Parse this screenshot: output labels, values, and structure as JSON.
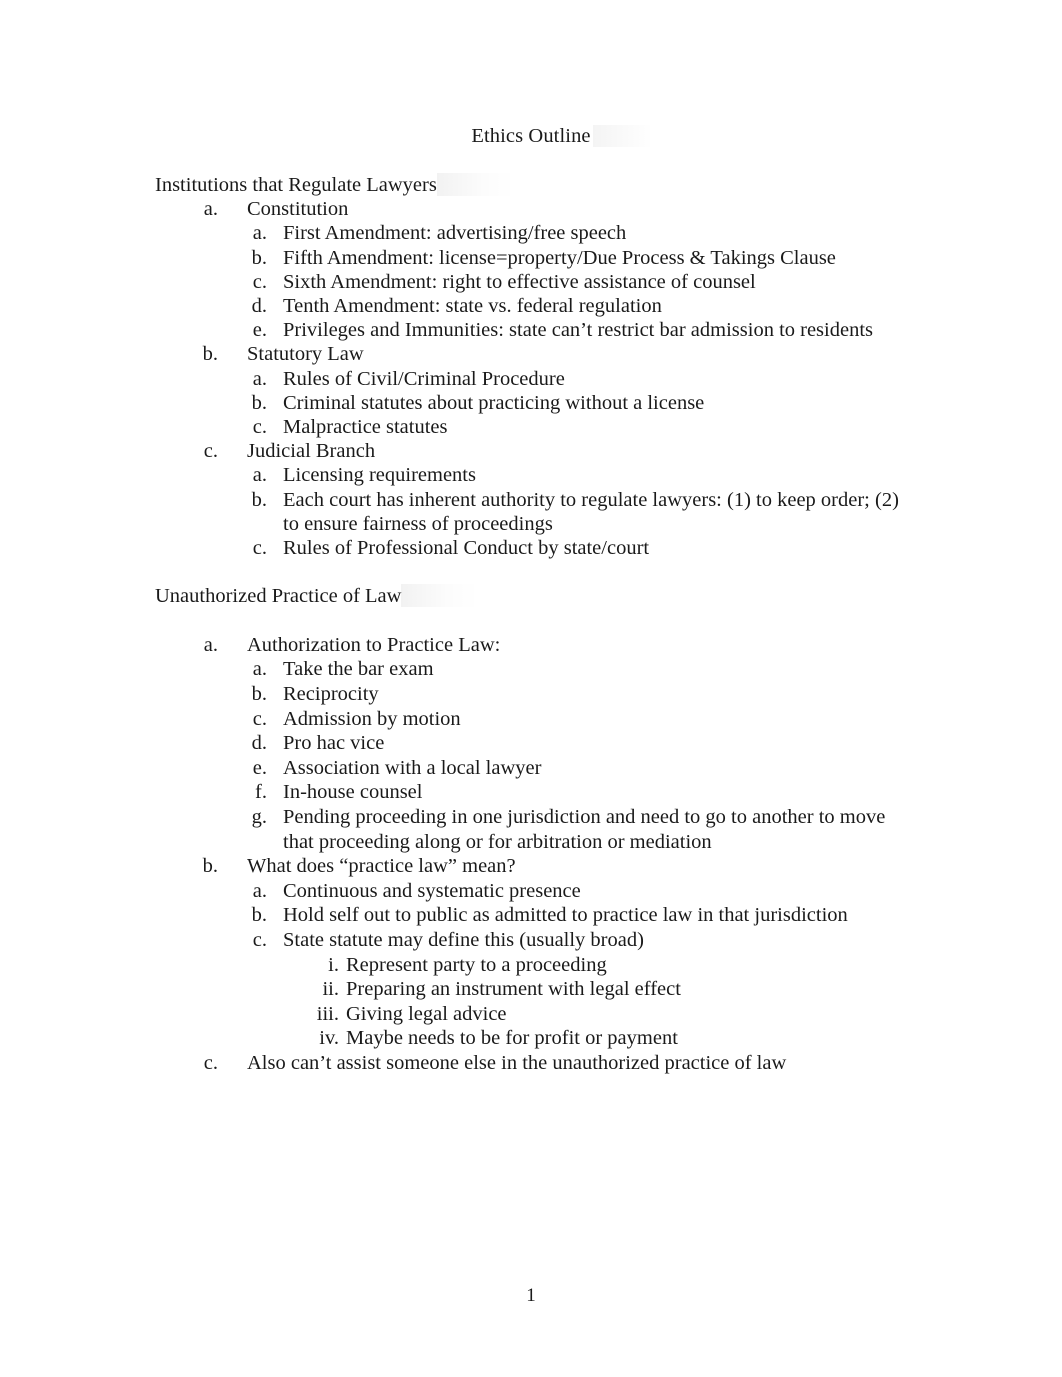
{
  "document": {
    "title": "Ethics Outline",
    "page_number": "1"
  },
  "sections": [
    {
      "heading": "Institutions that Regulate Lawyers",
      "items": [
        {
          "level": 1,
          "marker": "a.",
          "text": "Constitution"
        },
        {
          "level": 2,
          "marker": "a.",
          "text": "First Amendment: advertising/free speech"
        },
        {
          "level": 2,
          "marker": "b.",
          "text": "Fifth Amendment: license=property/Due Process & Takings Clause"
        },
        {
          "level": 2,
          "marker": "c.",
          "text": "Sixth Amendment: right to effective assistance of counsel"
        },
        {
          "level": 2,
          "marker": "d.",
          "text": "Tenth Amendment: state vs. federal regulation"
        },
        {
          "level": 2,
          "marker": "e.",
          "text": "Privileges and Immunities: state can’t restrict bar admission to residents"
        },
        {
          "level": 1,
          "marker": "b.",
          "text": "Statutory Law"
        },
        {
          "level": 2,
          "marker": "a.",
          "text": "Rules of Civil/Criminal Procedure"
        },
        {
          "level": 2,
          "marker": "b.",
          "text": "Criminal statutes about practicing without a license"
        },
        {
          "level": 2,
          "marker": "c.",
          "text": "Malpractice statutes"
        },
        {
          "level": 1,
          "marker": "c.",
          "text": "Judicial Branch"
        },
        {
          "level": 2,
          "marker": "a.",
          "text": "Licensing requirements"
        },
        {
          "level": 2,
          "marker": "b.",
          "text": "Each court has inherent authority to regulate lawyers: (1) to keep order; (2) to ensure fairness of proceedings"
        },
        {
          "level": 2,
          "marker": "c.",
          "text": "Rules of Professional Conduct by state/court"
        }
      ]
    },
    {
      "heading": "Unauthorized Practice of Law",
      "items": [
        {
          "level": 1,
          "marker": "a.",
          "text": "Authorization to Practice Law:"
        },
        {
          "level": 2,
          "marker": "a.",
          "text": "Take the bar exam"
        },
        {
          "level": 2,
          "marker": "b.",
          "text": "Reciprocity"
        },
        {
          "level": 2,
          "marker": "c.",
          "text": "Admission by motion"
        },
        {
          "level": 2,
          "marker": "d.",
          "text": "Pro hac vice"
        },
        {
          "level": 2,
          "marker": "e.",
          "text": "Association with a local lawyer"
        },
        {
          "level": 2,
          "marker": "f.",
          "text": "In-house counsel"
        },
        {
          "level": 2,
          "marker": "g.",
          "text": "Pending proceeding in one jurisdiction and need to go to another to move that proceeding along or for arbitration or mediation"
        },
        {
          "level": 1,
          "marker": "b.",
          "text": "What does “practice law” mean?"
        },
        {
          "level": 2,
          "marker": "a.",
          "text": "Continuous and systematic presence"
        },
        {
          "level": 2,
          "marker": "b.",
          "text": "Hold self out to public as admitted to practice law in that jurisdiction"
        },
        {
          "level": 2,
          "marker": "c.",
          "text": "State statute may define this (usually broad)"
        },
        {
          "level": 3,
          "marker": "i.",
          "text": "Represent party to a proceeding"
        },
        {
          "level": 3,
          "marker": "ii.",
          "text": "Preparing an instrument with legal effect"
        },
        {
          "level": 3,
          "marker": "iii.",
          "text": "Giving legal advice"
        },
        {
          "level": 3,
          "marker": "iv.",
          "text": "Maybe needs to be for profit or payment"
        },
        {
          "level": 1,
          "marker": "c.",
          "text": "Also can’t assist someone else in the unauthorized practice of law"
        }
      ]
    }
  ]
}
